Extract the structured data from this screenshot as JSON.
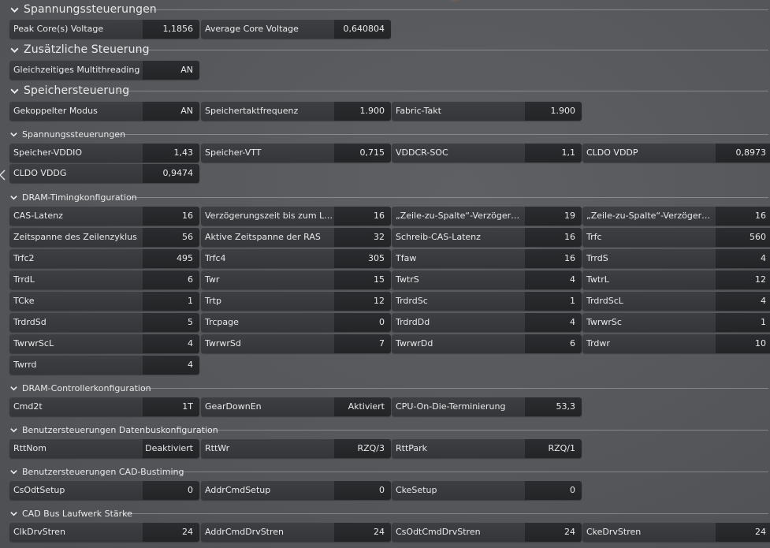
{
  "sections": {
    "voltage": {
      "title": "Spannungssteuerungen",
      "fields": [
        {
          "label": "Peak Core(s) Voltage",
          "value": "1,1856"
        },
        {
          "label": "Average Core Voltage",
          "value": "0,640804"
        }
      ]
    },
    "extra": {
      "title": "Zusätzliche Steuerung",
      "fields": [
        {
          "label": "Gleichzeitiges Multithreading",
          "value": "AN"
        }
      ]
    },
    "memory": {
      "title": "Speichersteuerung",
      "fields": [
        {
          "label": "Gekoppelter Modus",
          "value": "AN"
        },
        {
          "label": "Speichertaktfrequenz",
          "value": "1.900"
        },
        {
          "label": "Fabric-Takt",
          "value": "1.900"
        }
      ]
    },
    "mem_voltage": {
      "title": "Spannungssteuerungen",
      "fields": [
        {
          "label": "Speicher-VDDIO",
          "value": "1,43"
        },
        {
          "label": "Speicher-VTT",
          "value": "0,715"
        },
        {
          "label": "VDDCR-SOC",
          "value": "1,1"
        },
        {
          "label": "CLDO VDDP",
          "value": "0,8973"
        },
        {
          "label": "CLDO VDDG",
          "value": "0,9474"
        }
      ]
    },
    "dram_timing": {
      "title": "DRAM-Timingkonfiguration",
      "fields": [
        {
          "label": "CAS-Latenz",
          "value": "16"
        },
        {
          "label": "Verzögerungszeit bis zum Lade...",
          "value": "16"
        },
        {
          "label": "„Zeile-zu-Spalte“-Verzögerungs...",
          "value": "19"
        },
        {
          "label": "„Zeile-zu-Spalte“-Verzögerungs...",
          "value": "16"
        },
        {
          "label": "Zeitspanne des Zeilenzyklus",
          "value": "56"
        },
        {
          "label": "Aktive Zeitspanne der RAS",
          "value": "32"
        },
        {
          "label": "Schreib-CAS-Latenz",
          "value": "16"
        },
        {
          "label": "Trfc",
          "value": "560"
        },
        {
          "label": "Trfc2",
          "value": "495"
        },
        {
          "label": "Trfc4",
          "value": "305"
        },
        {
          "label": "Tfaw",
          "value": "16"
        },
        {
          "label": "TrrdS",
          "value": "4"
        },
        {
          "label": "TrrdL",
          "value": "6"
        },
        {
          "label": "Twr",
          "value": "15"
        },
        {
          "label": "TwtrS",
          "value": "4"
        },
        {
          "label": "TwtrL",
          "value": "12"
        },
        {
          "label": "TCke",
          "value": "1"
        },
        {
          "label": "Trtp",
          "value": "12"
        },
        {
          "label": "TrdrdSc",
          "value": "1"
        },
        {
          "label": "TrdrdScL",
          "value": "4"
        },
        {
          "label": "TrdrdSd",
          "value": "5"
        },
        {
          "label": "Trcpage",
          "value": "0"
        },
        {
          "label": "TrdrdDd",
          "value": "4"
        },
        {
          "label": "TwrwrSc",
          "value": "1"
        },
        {
          "label": "TwrwrScL",
          "value": "4"
        },
        {
          "label": "TwrwrSd",
          "value": "7"
        },
        {
          "label": "TwrwrDd",
          "value": "6"
        },
        {
          "label": "Trdwr",
          "value": "10"
        },
        {
          "label": "Twrrd",
          "value": "4"
        }
      ]
    },
    "dram_ctrl": {
      "title": "DRAM-Controllerkonfiguration",
      "fields": [
        {
          "label": "Cmd2t",
          "value": "1T"
        },
        {
          "label": "GearDownEn",
          "value": "Aktiviert"
        },
        {
          "label": "CPU-On-Die-Terminierung",
          "value": "53,3"
        }
      ]
    },
    "databus": {
      "title": "Benutzersteuerungen Datenbuskonfiguration",
      "fields": [
        {
          "label": "RttNom",
          "value": "Deaktiviert"
        },
        {
          "label": "RttWr",
          "value": "RZQ/3"
        },
        {
          "label": "RttPark",
          "value": "RZQ/1"
        }
      ]
    },
    "cad_timing": {
      "title": "Benutzersteuerungen CAD-Bustiming",
      "fields": [
        {
          "label": "CsOdtSetup",
          "value": "0"
        },
        {
          "label": "AddrCmdSetup",
          "value": "0"
        },
        {
          "label": "CkeSetup",
          "value": "0"
        }
      ]
    },
    "cad_drive": {
      "title": "CAD Bus Laufwerk Stärke",
      "fields": [
        {
          "label": "ClkDrvStren",
          "value": "24"
        },
        {
          "label": "AddrCmdDrvStren",
          "value": "24"
        },
        {
          "label": "CsOdtCmdDrvStren",
          "value": "24"
        },
        {
          "label": "CkeDrvStren",
          "value": "24"
        }
      ]
    }
  },
  "icons": [
    "chevron-down-icon",
    "chevron-left-icon"
  ]
}
